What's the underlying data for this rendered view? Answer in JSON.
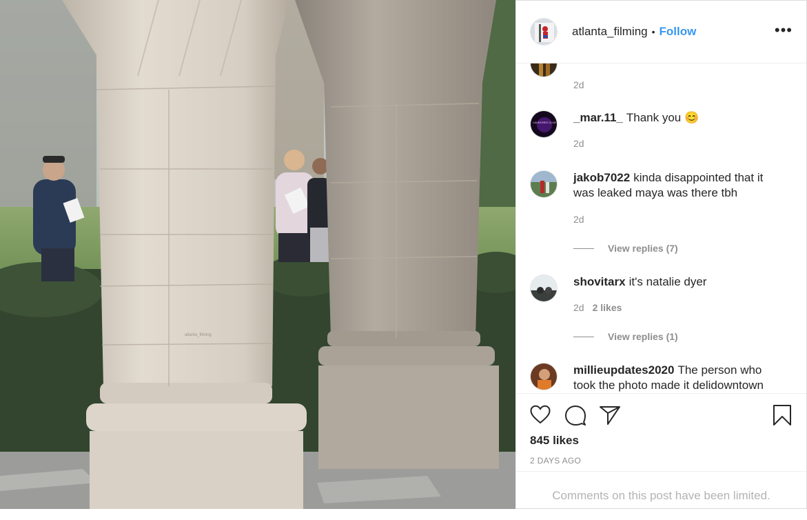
{
  "post": {
    "username": "atlanta_filming",
    "dot": "•",
    "follow_label": "Follow",
    "more_label": "•••",
    "image_watermark": "atlanta_filming"
  },
  "comments": [
    {
      "username": "",
      "text": "",
      "time": "2d"
    },
    {
      "username": "_mar.11_",
      "text": "Thank you 😊",
      "time": "2d",
      "avatar_text": "LAUNCHED CLUB"
    },
    {
      "username": "jakob7022",
      "text": "kinda disappointed that it was leaked maya was there tbh",
      "time": "2d",
      "replies_label": "View replies (7)"
    },
    {
      "username": "shovitarx",
      "text": "it's natalie dyer",
      "time": "2d",
      "likes": "2 likes",
      "replies_label": "View replies (1)"
    },
    {
      "username": "millieupdates2020",
      "text": "The person who took the photo made it delidowntown"
    }
  ],
  "actions": {
    "likes_count": "845 likes",
    "posted_ago": "2 DAYS AGO"
  },
  "footer": {
    "limited_text": "Comments on this post have been limited."
  },
  "icons": {
    "like": "heart-icon",
    "comment": "comment-bubble-icon",
    "share": "paper-plane-icon",
    "save": "bookmark-icon",
    "more": "more-options-icon"
  },
  "colors": {
    "follow_blue": "#3897f0",
    "muted_gray": "#8e8e8e",
    "border": "#dbdbdb"
  }
}
